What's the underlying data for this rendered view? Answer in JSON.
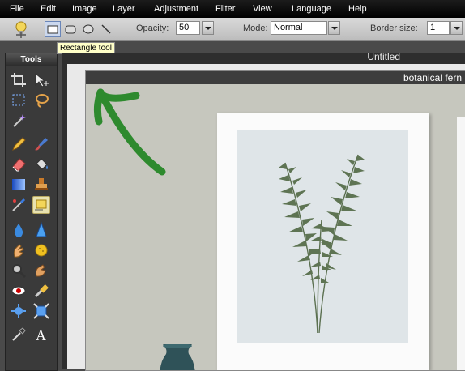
{
  "menu": [
    "File",
    "Edit",
    "Image",
    "Layer",
    "Adjustment",
    "Filter",
    "View",
    "Language",
    "Help"
  ],
  "options": {
    "opacity_label": "Opacity:",
    "opacity_value": "50",
    "mode_label": "Mode:",
    "mode_value": "Normal",
    "border_label": "Border size:",
    "border_value": "1"
  },
  "tooltip": "Rectangle tool",
  "tools_title": "Tools",
  "document_title": "Untitled",
  "image_title": "botanical fern",
  "annotation_color": "#2e8a2e",
  "tools": [
    "crop-tool",
    "move-tool",
    "marquee-tool",
    "lasso-tool",
    "magic-wand-tool",
    "",
    "pencil-tool",
    "brush-tool",
    "eraser-tool",
    "fill-tool",
    "gradient-tool",
    "clone-stamp-tool",
    "color-replace-tool",
    "shape-tool",
    "blur-tool",
    "sharpen-tool",
    "smudge-tool",
    "sponge-tool",
    "zoom-tool",
    "burn-tool",
    "red-eye-tool",
    "dodge-tool",
    "bloat-tool",
    "pinch-tool",
    "color-picker-tool",
    "type-tool"
  ]
}
